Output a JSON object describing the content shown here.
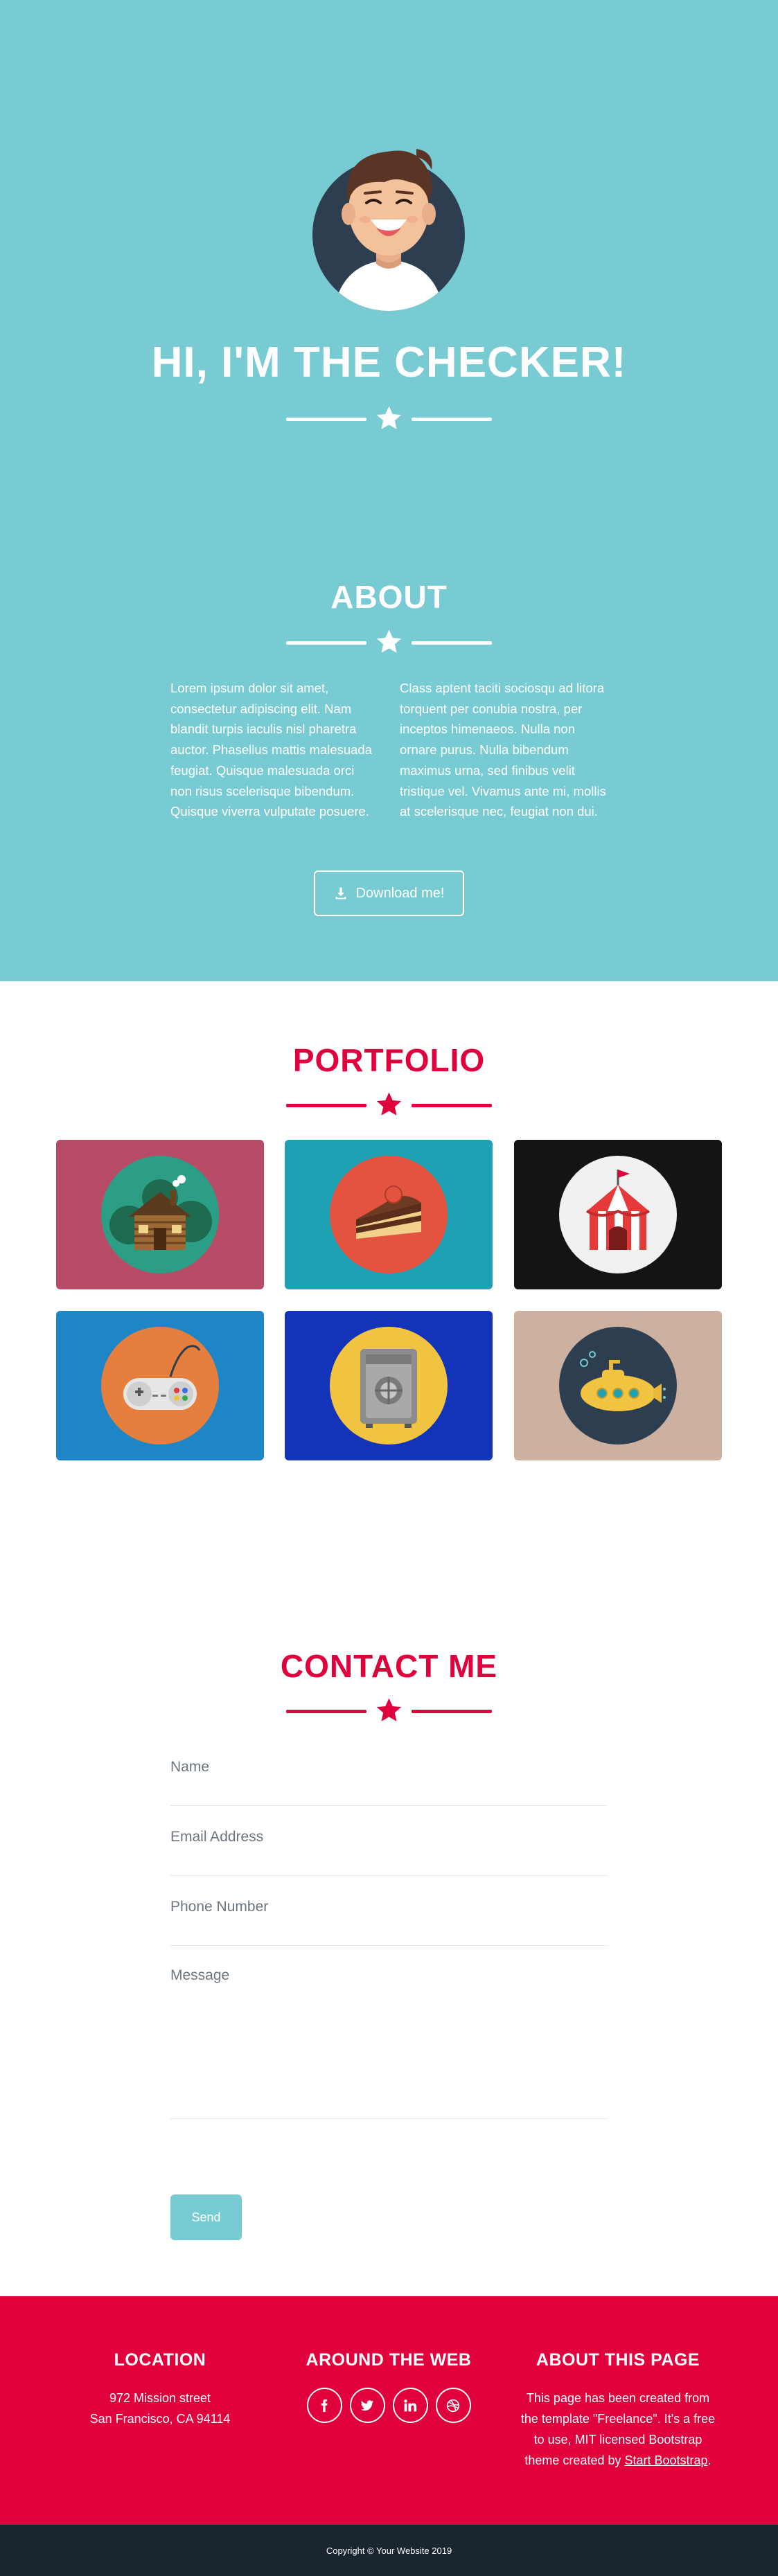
{
  "masthead": {
    "title": "HI, I'M THE CHECKER!",
    "background": "#78cbd2"
  },
  "about": {
    "title": "ABOUT",
    "paragraph_left": "Lorem ipsum dolor sit amet, consectetur adipiscing elit. Nam blandit turpis iaculis nisl pharetra auctor. Phasellus mattis malesuada feugiat. Quisque malesuada orci non risus scelerisque bibendum. Quisque viverra vulputate posuere.",
    "paragraph_right": "Class aptent taciti sociosqu ad litora torquent per conubia nostra, per inceptos himenaeos. Nulla non ornare purus. Nulla bibendum maximus urna, sed finibus velit tristique vel. Vivamus ante mi, mollis at scelerisque nec, feugiat non dui.",
    "download_label": "Download me!"
  },
  "portfolio": {
    "title": "PORTFOLIO",
    "accent": "#e0003c",
    "items": [
      {
        "icon": "cabin-icon",
        "bg": "#b84c66",
        "disc": "#2c9e86"
      },
      {
        "icon": "cake-icon",
        "bg": "#1ea1b3",
        "disc": "#e4533f"
      },
      {
        "icon": "circus-tent-icon",
        "bg": "#141414",
        "disc": "#f1f1f1"
      },
      {
        "icon": "game-controller-icon",
        "bg": "#1e86c6",
        "disc": "#e67e3e"
      },
      {
        "icon": "safe-icon",
        "bg": "#1334b9",
        "disc": "#f0c341"
      },
      {
        "icon": "submarine-icon",
        "bg": "#ccb1a1",
        "disc": "#2c3e50"
      }
    ]
  },
  "contact": {
    "title": "CONTACT ME",
    "name_placeholder": "Name",
    "email_placeholder": "Email Address",
    "phone_placeholder": "Phone Number",
    "message_placeholder": "Message",
    "send_label": "Send"
  },
  "footer": {
    "location_title": "LOCATION",
    "address_line1": "972 Mission street",
    "address_line2": "San Francisco, CA 94114",
    "web_title": "AROUND THE WEB",
    "socials": [
      "facebook-icon",
      "twitter-icon",
      "linkedin-icon",
      "dribbble-icon"
    ],
    "about_title": "ABOUT THIS PAGE",
    "about_text": "This page has been created from the template \"Freelance\". It's a free to use, MIT licensed Bootstrap theme created by ",
    "about_link": "Start Bootstrap",
    "about_end": ".",
    "background": "#e0003c"
  },
  "copyright": "Copyright © Your Website 2019"
}
